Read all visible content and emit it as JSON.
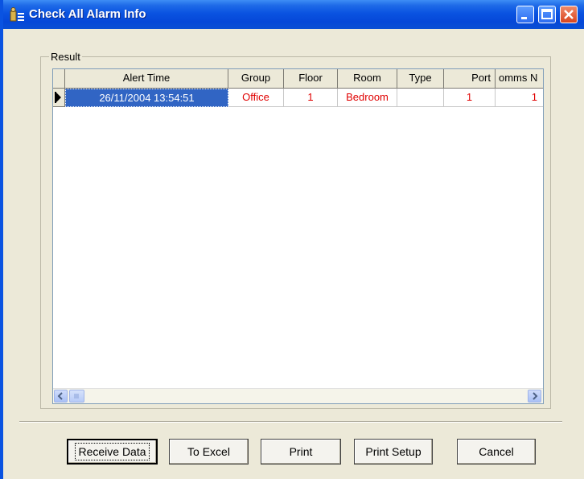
{
  "window": {
    "title": "Check All Alarm Info"
  },
  "result_group": {
    "label": "Result"
  },
  "grid": {
    "columns": [
      "Alert Time",
      "Group",
      "Floor",
      "Room",
      "Type",
      "Port",
      "omms N"
    ],
    "rows": [
      {
        "alert_time": "26/11/2004 13:54:51",
        "group": "Office",
        "floor": "1",
        "room": "Bedroom",
        "type": "",
        "port": "1",
        "comms": "1"
      }
    ]
  },
  "buttons": {
    "receive_data": "Receive Data",
    "to_excel": "To Excel",
    "print": "Print",
    "print_setup": "Print Setup",
    "cancel": "Cancel"
  },
  "colors": {
    "titlebar": "#0A53E1",
    "selection": "#3165C4",
    "cell_text": "#E00000",
    "face": "#ECE9D8"
  }
}
